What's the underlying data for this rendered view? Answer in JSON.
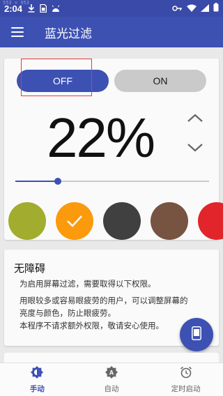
{
  "debug_text": "553 × 953",
  "status_bar": {
    "time": "2:04",
    "icons": [
      "download-icon",
      "sim-card-icon",
      "android-icon",
      "key-icon",
      "wifi-icon",
      "signal-icon",
      "battery-icon"
    ]
  },
  "app_bar": {
    "title": "蓝光过滤",
    "menu_icon": "hamburger-menu-icon"
  },
  "toggle": {
    "off_label": "OFF",
    "on_label": "ON",
    "active": "OFF"
  },
  "intensity": {
    "value": "22",
    "unit": "%",
    "slider_fraction": 0.22
  },
  "swatches": [
    {
      "color": "#a2ac2e",
      "selected": false
    },
    {
      "color": "#fb9a0d",
      "selected": true
    },
    {
      "color": "#404040",
      "selected": false
    },
    {
      "color": "#775342",
      "selected": false
    },
    {
      "color": "#e2252b",
      "selected": false
    }
  ],
  "info_card": {
    "title": "无障碍",
    "line1": "为启用屏幕过滤，需要取得以下权限。",
    "line2": "用眼较多或容易眼疲劳的用户，可以调整屏幕的",
    "line3": "亮度与颜色，防止眼疲劳。",
    "line4": "本程序不请求额外权限，敬请安心使用。"
  },
  "fab": {
    "icon": "phone-icon"
  },
  "bottom_nav": [
    {
      "label": "手动",
      "icon": "brightness-icon",
      "active": true
    },
    {
      "label": "自动",
      "icon": "auto-brightness-icon",
      "active": false
    },
    {
      "label": "定时启动",
      "icon": "alarm-clock-icon",
      "active": false
    }
  ],
  "colors": {
    "primary": "#3d51b3",
    "status_bar": "#3a4aa8",
    "toggle_inactive": "#cacaca",
    "highlight": "#e53935"
  }
}
